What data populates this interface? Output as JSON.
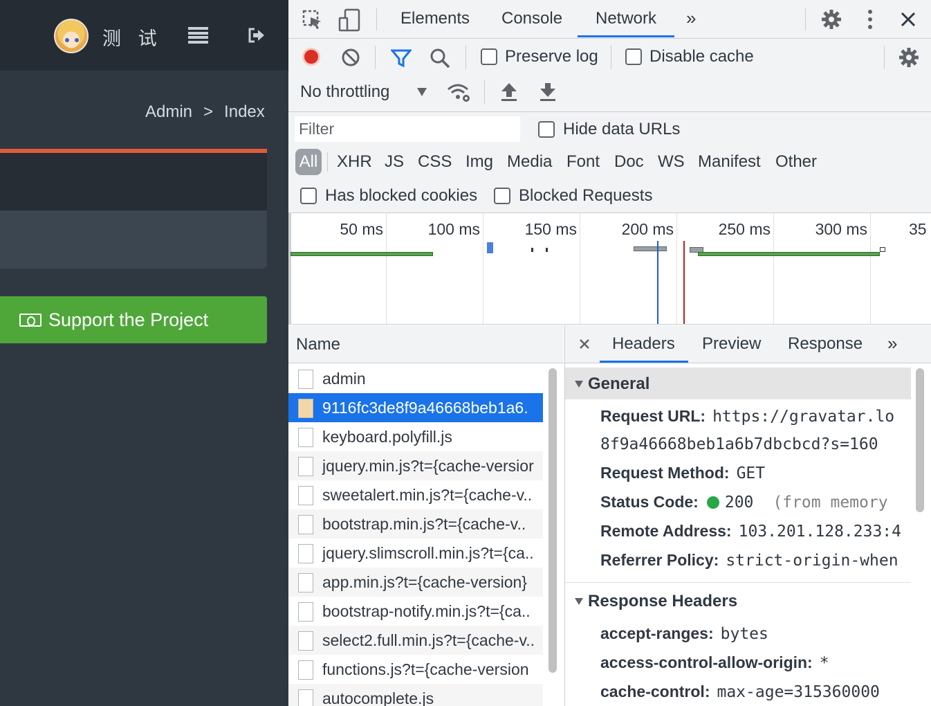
{
  "app": {
    "user_name": "测 试",
    "breadcrumb": {
      "root": "Admin",
      "separator": ">",
      "current": "Index"
    },
    "support_button": "Support the Project"
  },
  "devtools": {
    "tabs": [
      "Elements",
      "Console",
      "Network"
    ],
    "active_tab": "Network",
    "toolbar": {
      "preserve_log": "Preserve log",
      "disable_cache": "Disable cache",
      "throttling": "No throttling"
    },
    "filter": {
      "placeholder": "Filter",
      "hide_data_urls": "Hide data URLs",
      "types": [
        "All",
        "XHR",
        "JS",
        "CSS",
        "Img",
        "Media",
        "Font",
        "Doc",
        "WS",
        "Manifest",
        "Other"
      ],
      "has_blocked_cookies": "Has blocked cookies",
      "blocked_requests": "Blocked Requests"
    },
    "timeline_ticks": [
      "50 ms",
      "100 ms",
      "150 ms",
      "200 ms",
      "250 ms",
      "300 ms",
      "35"
    ],
    "request_list": {
      "header": "Name",
      "items": [
        "admin",
        "9116fc3de8f9a46668beb1a6.",
        "keyboard.polyfill.js",
        "jquery.min.js?t={cache-versior",
        "sweetalert.min.js?t={cache-v..",
        "bootstrap.min.js?t={cache-v..",
        "jquery.slimscroll.min.js?t={ca..",
        "app.min.js?t={cache-version}",
        "bootstrap-notify.min.js?t={ca..",
        "select2.full.min.js?t={cache-v..",
        "functions.js?t={cache-version",
        "autocomplete.js"
      ],
      "selected_index": 1
    },
    "details": {
      "tabs": [
        "Headers",
        "Preview",
        "Response"
      ],
      "active_tab": "Headers",
      "general_title": "General",
      "request_url_label": "Request URL:",
      "request_url_value": "https://gravatar.lo",
      "request_url_cont": "8f9a46668beb1a6b7dbcbcd?s=160",
      "method_label": "Request Method:",
      "method_value": "GET",
      "status_label": "Status Code:",
      "status_value": "200",
      "status_note": "(from memory",
      "remote_label": "Remote Address:",
      "remote_value": "103.201.128.233:4",
      "referrer_label": "Referrer Policy:",
      "referrer_value": "strict-origin-when",
      "response_title": "Response Headers",
      "accept_ranges_label": "accept-ranges:",
      "accept_ranges_value": "bytes",
      "acao_label": "access-control-allow-origin:",
      "acao_value": "*",
      "cache_control_label": "cache-control:",
      "cache_control_value": "max-age=315360000"
    }
  },
  "colors": {
    "support_green": "#4fa73a",
    "accent_red": "#e05a3c",
    "record_red": "#d93025",
    "selection_blue": "#1a73e8",
    "status_green": "#28a745"
  }
}
